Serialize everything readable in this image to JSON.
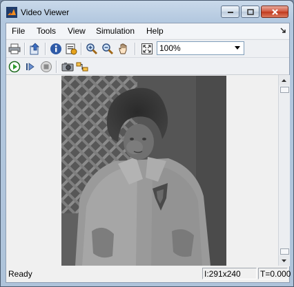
{
  "window": {
    "title": "Video Viewer",
    "title_icon": "matlab-logo-icon",
    "controls": [
      "minimize-icon",
      "maximize-icon",
      "close-icon"
    ]
  },
  "menu": {
    "items": [
      {
        "label": "File"
      },
      {
        "label": "Tools"
      },
      {
        "label": "View"
      },
      {
        "label": "Simulation"
      },
      {
        "label": "Help"
      }
    ],
    "corner_icon": "dock-arrow-icon"
  },
  "toolbar1": {
    "buttons": [
      "print-icon",
      "bring-to-front-icon",
      "info-icon",
      "properties-icon",
      "zoom-in-icon",
      "zoom-out-icon",
      "pan-hand-icon",
      "fit-to-window-icon"
    ],
    "zoom": {
      "value": "100%"
    }
  },
  "toolbar2": {
    "buttons": [
      "run-icon",
      "step-forward-icon",
      "stop-icon",
      "snapshot-icon",
      "highlight-signal-icon"
    ]
  },
  "status": {
    "text": "Ready",
    "dimensions": "I:291x240",
    "time": "T=0.000"
  },
  "colors": {
    "run_green": "#2e9b2e",
    "stop_gray": "#8a8a8a",
    "titlebar": "#b8cbe0"
  }
}
